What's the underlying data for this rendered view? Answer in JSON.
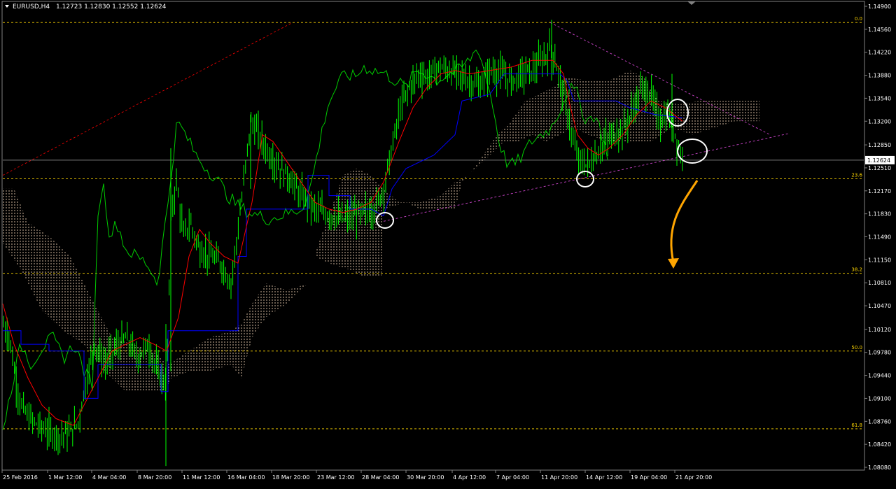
{
  "window": {
    "symbol_title": "EURUSD,H4",
    "ohlc": "1.12723 1.12830 1.12552 1.12624"
  },
  "colors": {
    "background": "#000000",
    "candle": "#00ff00",
    "chikou": "#00cc00",
    "tenkan": "#ff0000",
    "kijun": "#0000ff",
    "cloud": "#ffe0c0",
    "fib": "#ffd700",
    "trend": "#cc44cc",
    "current_price_line": "#c0c0c0",
    "arrow": "#ffa500",
    "axis_text": "#ffffff"
  },
  "price_axis": {
    "labels": [
      "1.14900",
      "1.14560",
      "1.14220",
      "1.13880",
      "1.13540",
      "1.13200",
      "1.12850",
      "1.12510",
      "1.12170",
      "1.11830",
      "1.11490",
      "1.11150",
      "1.10810",
      "1.10470",
      "1.10120",
      "1.09780",
      "1.09440",
      "1.09100",
      "1.08760",
      "1.08420",
      "1.08080"
    ],
    "current_price": "1.12624"
  },
  "time_axis": {
    "labels": [
      "25 Feb 2016",
      "1 Mar 12:00",
      "4 Mar 04:00",
      "8 Mar 20:00",
      "11 Mar 12:00",
      "16 Mar 04:00",
      "18 Mar 20:00",
      "23 Mar 12:00",
      "28 Mar 04:00",
      "30 Mar 20:00",
      "4 Apr 12:00",
      "7 Apr 04:00",
      "11 Apr 20:00",
      "14 Apr 12:00",
      "19 Apr 04:00",
      "21 Apr 20:00"
    ]
  },
  "fibonacci": {
    "levels": [
      "0.0",
      "23.6",
      "38.2",
      "50.0",
      "61.8"
    ],
    "prices": [
      1.1466,
      1.1235,
      1.1095,
      1.098,
      1.0865
    ]
  },
  "chart_data": {
    "type": "candlestick",
    "symbol": "EURUSD",
    "timeframe": "H4",
    "ylim": [
      1.0808,
      1.149
    ],
    "x_range": [
      "25 Feb 2016",
      "22 Apr 2016"
    ],
    "indicators": [
      "Ichimoku Kinko Hyo",
      "Fibonacci retracement"
    ],
    "fib_levels": [
      "0.0",
      "23.6",
      "38.2",
      "50.0",
      "61.8"
    ],
    "trendlines": [
      "upper descending",
      "lower ascending",
      "long ascending"
    ],
    "annotations": [
      "circles at swing points",
      "orange down arrow"
    ],
    "close_path": [
      [
        "25 Feb 2016",
        1.102
      ],
      [
        "27 Feb 2016",
        1.093
      ],
      [
        "29 Feb 2016",
        1.087
      ],
      [
        "1 Mar 12:00",
        1.086
      ],
      [
        "2 Mar 2016",
        1.088
      ],
      [
        "3 Mar 2016",
        1.093
      ],
      [
        "4 Mar 04:00",
        1.099
      ],
      [
        "5 Mar 2016",
        1.096
      ],
      [
        "7 Mar 2016",
        1.1
      ],
      [
        "8 Mar 20:00",
        1.096
      ],
      [
        "9 Mar 2016",
        1.093
      ],
      [
        "10 Mar 2016",
        1.118
      ],
      [
        "11 Mar 12:00",
        1.113
      ],
      [
        "13 Mar 2016",
        1.115
      ],
      [
        "15 Mar 2016",
        1.111
      ],
      [
        "16 Mar 04:00",
        1.108
      ],
      [
        "17 Mar 2016",
        1.132
      ],
      [
        "18 Mar 20:00",
        1.126
      ],
      [
        "21 Mar 2016",
        1.124
      ],
      [
        "22 Mar 2016",
        1.12
      ],
      [
        "23 Mar 12:00",
        1.1185
      ],
      [
        "25 Mar 2016",
        1.118
      ],
      [
        "28 Mar 04:00",
        1.119
      ],
      [
        "29 Mar 2016",
        1.128
      ],
      [
        "30 Mar 20:00",
        1.138
      ],
      [
        "1 Apr 2016",
        1.1395
      ],
      [
        "4 Apr 12:00",
        1.139
      ],
      [
        "5 Apr 2016",
        1.137
      ],
      [
        "7 Apr 04:00",
        1.139
      ],
      [
        "8 Apr 2016",
        1.138
      ],
      [
        "11 Apr 20:00",
        1.143
      ],
      [
        "12 Apr 2016",
        1.138
      ],
      [
        "13 Apr 2016",
        1.128
      ],
      [
        "14 Apr 12:00",
        1.126
      ],
      [
        "15 Apr 2016",
        1.129
      ],
      [
        "18 Apr 2016",
        1.131
      ],
      [
        "19 Apr 04:00",
        1.135
      ],
      [
        "20 Apr 2016",
        1.136
      ],
      [
        "21 Apr 20:00",
        1.13
      ],
      [
        "22 Apr 2016",
        1.1262
      ]
    ]
  }
}
